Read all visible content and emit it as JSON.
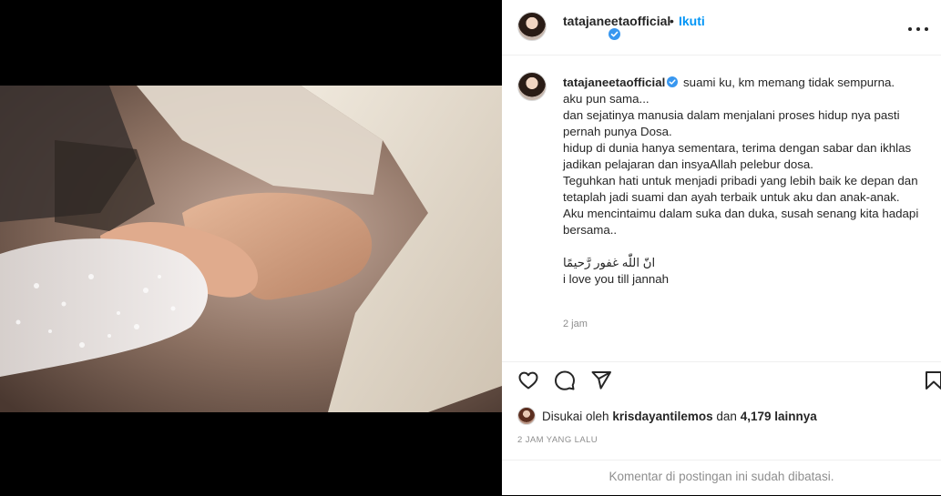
{
  "header": {
    "username": "tatajaneetaofficial",
    "dot": "•",
    "follow_label": "Ikuti",
    "verified_icon": "verified-badge-icon",
    "more_icon": "more-options-icon"
  },
  "caption": {
    "username": "tatajaneetaofficial",
    "lines": [
      "suami ku, km memang tidak sempurna.",
      "aku pun sama...",
      "dan sejatinya manusia dalam menjalani proses hidup nya pasti pernah punya Dosa.",
      "hidup di dunia hanya sementara, terima dengan sabar dan ikhlas jadikan pelajaran dan insyaAllah pelebur dosa.",
      "Teguhkan hati untuk menjadi pribadi yang lebih baik ke depan dan tetaplah jadi suami dan ayah terbaik untuk aku dan anak-anak.",
      "Aku mencintaimu dalam suka dan duka, susah senang kita hadapi bersama..",
      "",
      "انّ اللّٰه غفور رَّحيمًا",
      "i love you till jannah"
    ],
    "time": "2 jam"
  },
  "actions": {
    "like_icon": "heart-icon",
    "comment_icon": "comment-icon",
    "share_icon": "share-icon",
    "save_icon": "bookmark-icon"
  },
  "likes": {
    "prefix": "Disukai oleh",
    "liker": "krisdayantilemos",
    "joiner": "dan",
    "others": "4,179 lainnya"
  },
  "post_time": "2 JAM YANG LALU",
  "comments_off": "Komentar di postingan ini sudah dibatasi.",
  "colors": {
    "accent": "#0095f6",
    "text": "#262626",
    "muted": "#8e8e8e",
    "border": "#efefef"
  }
}
